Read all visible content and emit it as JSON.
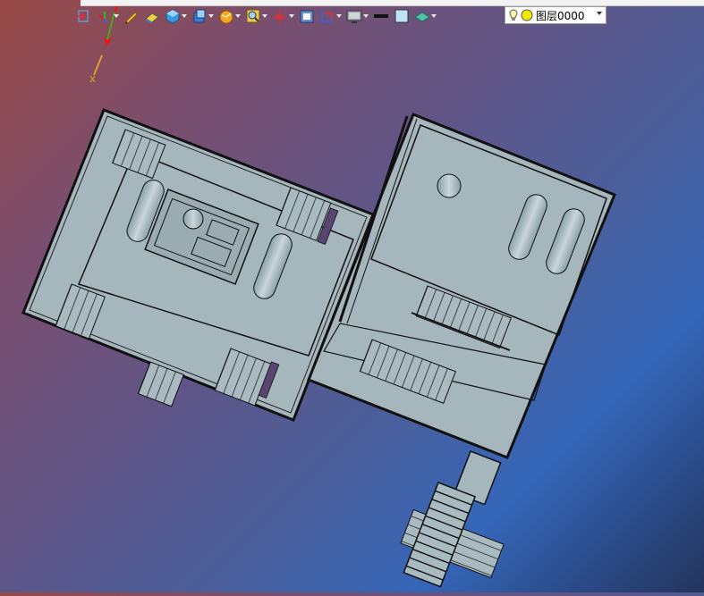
{
  "layer": {
    "name": "图层0000",
    "bulb_icon": "lightbulb-icon",
    "color_icon": "yellow-circle-icon"
  },
  "toolbar": {
    "tools": [
      {
        "icon": "exit-view-icon"
      },
      {
        "icon": "ucs-axis-icon",
        "has_menu": true
      },
      {
        "icon": "pencil-icon"
      },
      {
        "icon": "eraser-icon"
      },
      {
        "icon": "cube-icon",
        "has_menu": true
      },
      {
        "icon": "view-cube-icon",
        "has_menu": true
      },
      {
        "icon": "render-sphere-icon",
        "has_menu": true
      },
      {
        "icon": "zoom-icon",
        "has_menu": true
      },
      {
        "icon": "pan-icon",
        "has_menu": true
      },
      {
        "icon": "frame-icon"
      },
      {
        "icon": "section-icon",
        "has_menu": true
      },
      {
        "icon": "monitor-icon",
        "has_menu": true
      },
      {
        "icon": "line-color-icon"
      },
      {
        "icon": "fill-color-icon"
      },
      {
        "icon": "material-icon",
        "has_menu": true
      }
    ]
  },
  "colors": {
    "model_fill": "#a5b6bd",
    "model_stroke": "#1a1a1a",
    "accent_purple": "#5a4472"
  }
}
